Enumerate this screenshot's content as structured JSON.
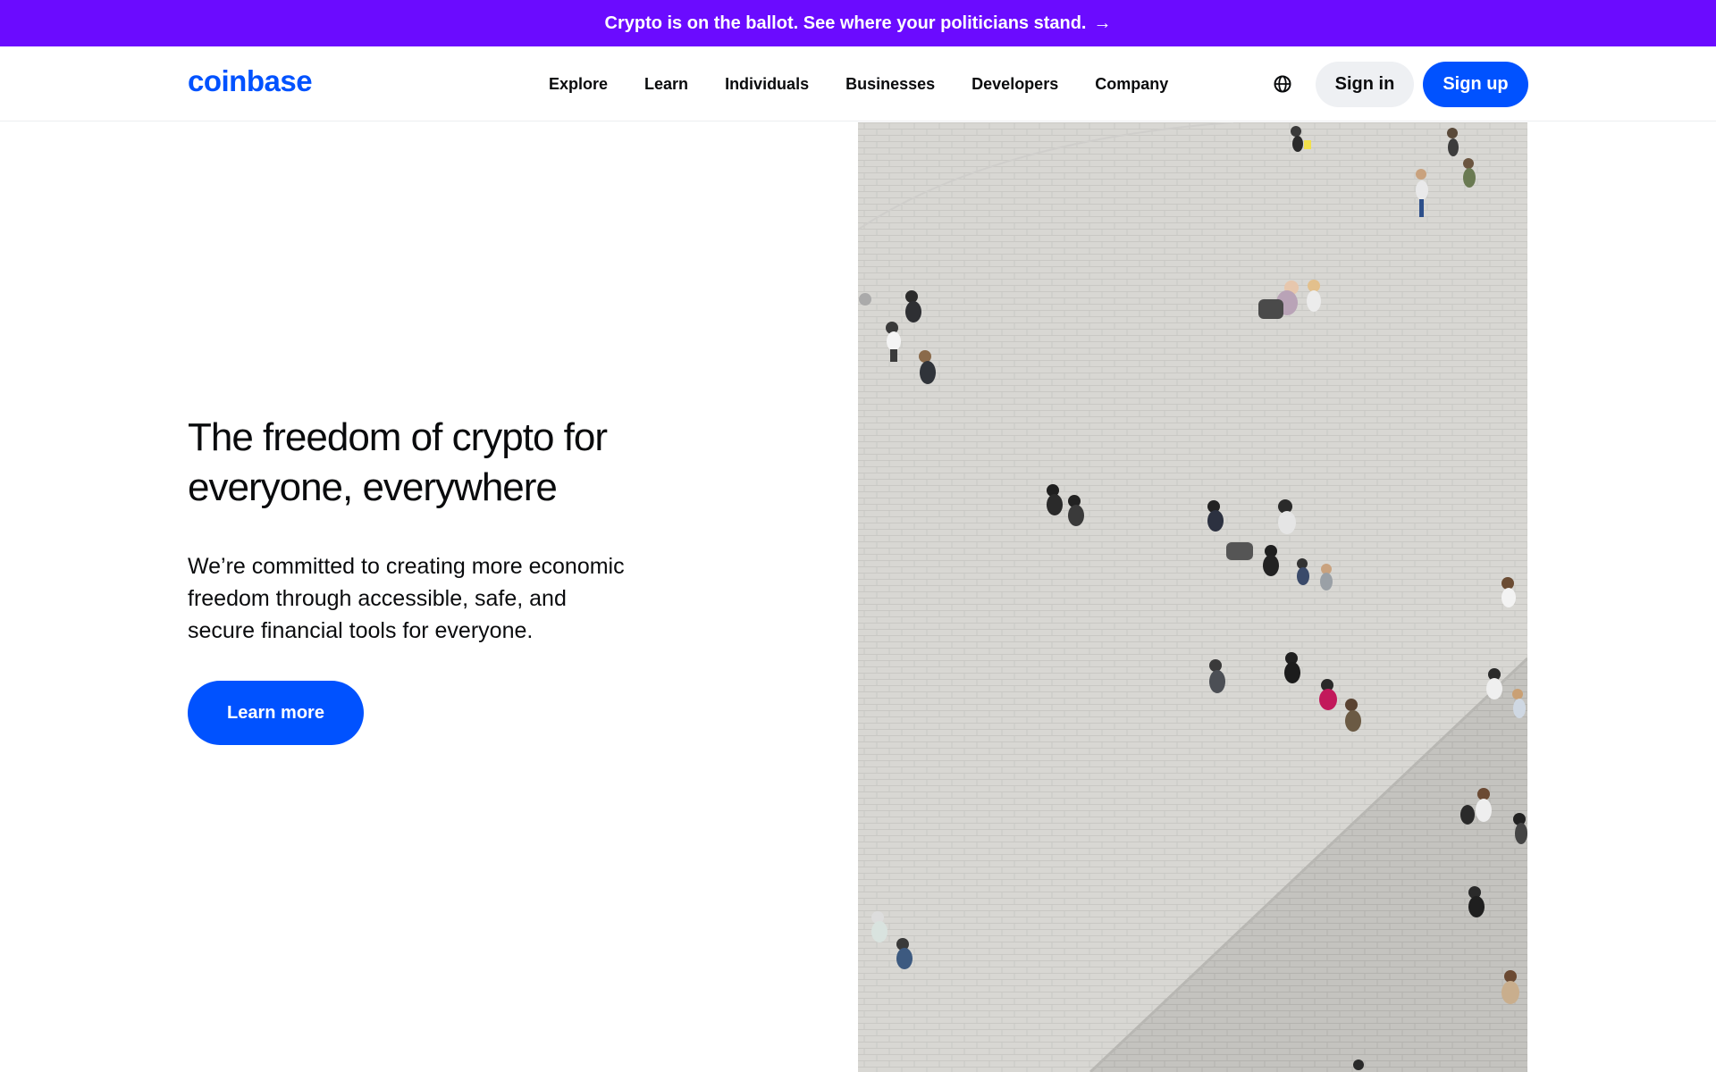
{
  "banner": {
    "text": "Crypto is on the ballot. See where your politicians stand.",
    "arrow": "→"
  },
  "header": {
    "logo": "coinbase",
    "nav": [
      "Explore",
      "Learn",
      "Individuals",
      "Businesses",
      "Developers",
      "Company"
    ],
    "language_icon": "globe-icon",
    "signin_label": "Sign in",
    "signup_label": "Sign up"
  },
  "hero": {
    "title_line1": "The freedom of crypto for",
    "title_line2": "everyone, everywhere",
    "body_line1": "We’re committed to creating more economic",
    "body_line2": "freedom through accessible, safe, and",
    "body_line3": "secure financial tools for everyone.",
    "cta_label": "Learn more"
  },
  "colors": {
    "banner_bg": "#6b0bff",
    "brand_blue": "#0052ff",
    "signin_bg": "#eef0f3",
    "pavement": "#d9d8d4"
  }
}
